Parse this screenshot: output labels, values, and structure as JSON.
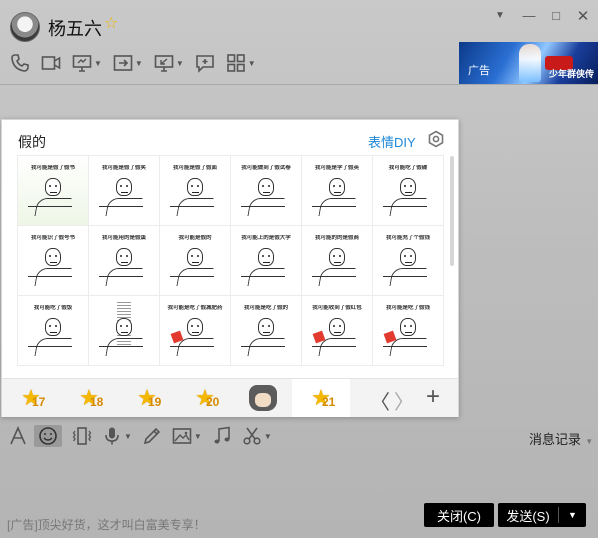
{
  "header": {
    "username": "杨五六",
    "vip_icon": "☆",
    "window_controls": {
      "menu": "▼",
      "minimize": "—",
      "maximize": "□",
      "close": "✕"
    }
  },
  "toolbar": {
    "items": [
      {
        "name": "phone-icon",
        "caret": false
      },
      {
        "name": "video-icon",
        "caret": false
      },
      {
        "name": "screen-share-icon",
        "caret": true
      },
      {
        "name": "file-transfer-icon",
        "caret": true
      },
      {
        "name": "remote-desktop-icon",
        "caret": true
      },
      {
        "name": "message-icon",
        "caret": false
      },
      {
        "name": "apps-icon",
        "caret": true
      }
    ]
  },
  "ad_banner": {
    "label": "广告",
    "title": "少年群侠传"
  },
  "emoji_panel": {
    "title": "假的",
    "diy_link": "表情DIY",
    "stickers": [
      {
        "caption": "我可能是假了假书",
        "style": "green"
      },
      {
        "caption": "我可能是假了假笑",
        "style": ""
      },
      {
        "caption": "我可能是假了假面",
        "style": ""
      },
      {
        "caption": "我可能做到了假试卷",
        "style": ""
      },
      {
        "caption": "我可能是学了假英",
        "style": ""
      },
      {
        "caption": "我可能吃了假碟",
        "style": ""
      },
      {
        "caption": "我可能识了假号书",
        "style": ""
      },
      {
        "caption": "我可能用的是假蛋",
        "style": ""
      },
      {
        "caption": "我可能是假的",
        "style": ""
      },
      {
        "caption": "我可能上的是假大学",
        "style": ""
      },
      {
        "caption": "我可能的的是假商",
        "style": ""
      },
      {
        "caption": "我可能充了个假钱",
        "style": ""
      },
      {
        "caption": "我可能吃了假饭",
        "style": ""
      },
      {
        "caption": "",
        "style": "text"
      },
      {
        "caption": "我可能是吃了假减肥药",
        "style": "red"
      },
      {
        "caption": "我可能是吃了假的",
        "style": ""
      },
      {
        "caption": "我可能收到了假红包",
        "style": "red"
      },
      {
        "caption": "我可能是吃了假钱",
        "style": "red"
      }
    ],
    "tabs": [
      {
        "label": "17",
        "type": "star",
        "active": false
      },
      {
        "label": "18",
        "type": "star",
        "active": false
      },
      {
        "label": "19",
        "type": "star",
        "active": false
      },
      {
        "label": "20",
        "type": "star",
        "active": false
      },
      {
        "label": "",
        "type": "cat",
        "active": false
      },
      {
        "label": "21",
        "type": "star",
        "active": true
      }
    ],
    "nav_prev": "〈",
    "nav_next": "〉",
    "add": "+"
  },
  "input_toolbar": {
    "items": [
      {
        "name": "font-icon",
        "caret": false,
        "active": false
      },
      {
        "name": "emoji-icon",
        "caret": false,
        "active": true
      },
      {
        "name": "vibrate-icon",
        "caret": false,
        "active": false
      },
      {
        "name": "voice-icon",
        "caret": true,
        "active": false
      },
      {
        "name": "pen-icon",
        "caret": false,
        "active": false
      },
      {
        "name": "image-icon",
        "caret": true,
        "active": false
      },
      {
        "name": "music-icon",
        "caret": false,
        "active": false
      },
      {
        "name": "scissors-icon",
        "caret": true,
        "active": false
      }
    ],
    "history_label": "消息记录"
  },
  "footer": {
    "ad_text": "[广告]顶尖好货，这才叫白富美专享！",
    "close_label": "关闭(C)",
    "send_label": "发送(S)",
    "send_caret": "▼"
  },
  "colors": {
    "accent_link": "#1e88d8",
    "star": "#f5b800",
    "button_bg": "#000000"
  }
}
